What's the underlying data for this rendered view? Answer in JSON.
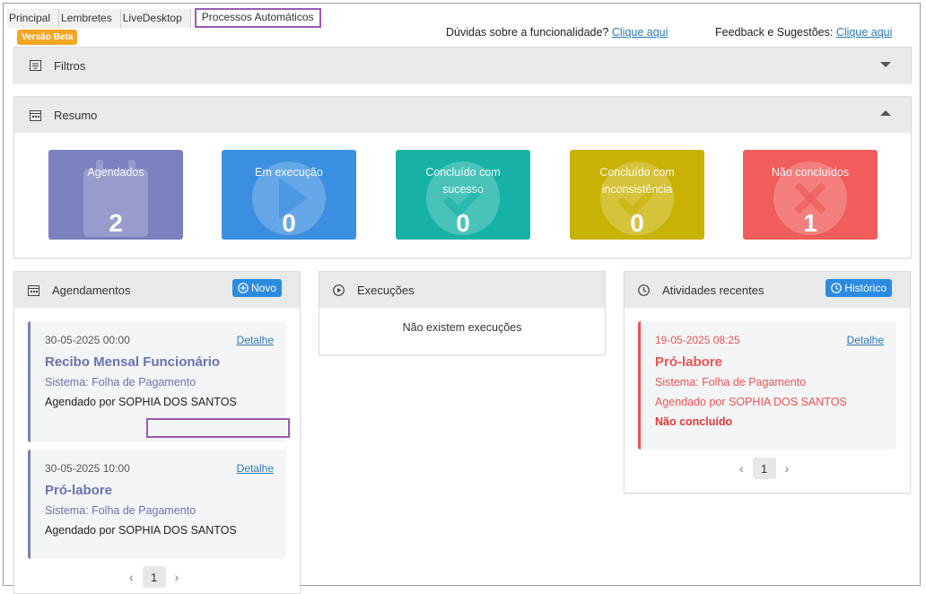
{
  "tabs": [
    "Principal",
    "Lembretes",
    "LiveDesktop",
    "Processos Automáticos"
  ],
  "beta_badge": "Versão Beta",
  "help": {
    "text": "Dúvidas sobre a funcionalidade?",
    "link": "Clique aqui"
  },
  "feedback": {
    "text": "Feedback e Sugestões:",
    "link": "Clique aqui"
  },
  "filters": {
    "title": "Filtros"
  },
  "summary": {
    "title": "Resumo",
    "cards": [
      {
        "label": "Agendados",
        "value": "2",
        "color": "#7b80bf",
        "icon": "calendar-icon"
      },
      {
        "label": "Em execução",
        "value": "0",
        "color": "#3b8fe0",
        "icon": "play-icon"
      },
      {
        "label": "Concluído com sucesso",
        "value": "0",
        "color": "#17b2a6",
        "icon": "check-icon"
      },
      {
        "label": "Concluído com inconsistência",
        "value": "0",
        "color": "#c9b206",
        "icon": "check-icon"
      },
      {
        "label": "Não concluídos",
        "value": "1",
        "color": "#f05d5a",
        "icon": "x-icon"
      }
    ]
  },
  "schedules": {
    "title": "Agendamentos",
    "new_button": "Novo",
    "items": [
      {
        "date": "30-05-2025 00:00",
        "detail": "Detalhe",
        "title": "Recibo Mensal Funcionário",
        "system": "Sistema: Folha de Pagamento",
        "by": "Agendado por  SOPHIA DOS SANTOS"
      },
      {
        "date": "30-05-2025 10:00",
        "detail": "Detalhe",
        "title": "Pró-labore",
        "system": "Sistema: Folha de Pagamento",
        "by": "Agendado por SOPHIA DOS SANTOS"
      }
    ],
    "page": "1"
  },
  "executions": {
    "title": "Execuções",
    "empty": "Não existem execuções"
  },
  "activities": {
    "title": "Atividades recentes",
    "history_button": "Histórico",
    "items": [
      {
        "date": "19-05-2025 08:25",
        "detail": "Detalhe",
        "title": "Pró-labore",
        "system": "Sistema: Folha de Pagamento",
        "by": "Agendado por SOPHIA DOS SANTOS",
        "status": "Não concluído"
      }
    ],
    "page": "1"
  },
  "colors": {
    "accent": "#2c8be0",
    "highlight": "#9b59b6",
    "beta": "#f5a623"
  }
}
